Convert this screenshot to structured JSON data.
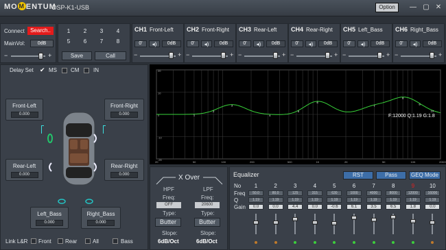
{
  "app": {
    "logo": "MOMENTUM",
    "title": "DSP-K1-USB",
    "option_label": "Option"
  },
  "window": {
    "min_glyph": "—",
    "max_glyph": "▢",
    "close_glyph": "✕"
  },
  "connect": {
    "connect_label": "Connect",
    "search_label": "Search..",
    "mainvol_label": "MainVol:",
    "mainvol_value": "0dB",
    "minus": "−",
    "plus": "+"
  },
  "presets": {
    "buttons": [
      "1",
      "2",
      "3",
      "4",
      "5",
      "6",
      "7",
      "8"
    ],
    "save": "Save",
    "call": "Call"
  },
  "channels": [
    {
      "code": "CH1",
      "name": "Front-Left",
      "delay": "0'",
      "gain": "0dB"
    },
    {
      "code": "CH2",
      "name": "Front-Right",
      "delay": "0'",
      "gain": "0dB"
    },
    {
      "code": "CH3",
      "name": "Rear-Left",
      "delay": "0'",
      "gain": "0dB"
    },
    {
      "code": "CH4",
      "name": "Rear-Right",
      "delay": "0'",
      "gain": "0dB"
    },
    {
      "code": "CH5",
      "name": "Left_Bass",
      "delay": "0'",
      "gain": "0dB"
    },
    {
      "code": "CH6",
      "name": "Right_Bass",
      "delay": "0'",
      "gain": "0dB"
    }
  ],
  "delay_set": {
    "label": "Delay Set",
    "options": [
      "MS",
      "CM",
      "IN"
    ],
    "checked": "MS"
  },
  "speakers": [
    {
      "name": "Front-Left",
      "value": "0.000"
    },
    {
      "name": "Front-Right",
      "value": "0.000"
    },
    {
      "name": "Rear-Left",
      "value": "0.000"
    },
    {
      "name": "Rear-Right",
      "value": "0.000"
    },
    {
      "name": "Left_Bass",
      "value": "0.000"
    },
    {
      "name": "Right_Bass",
      "value": "0.000"
    }
  ],
  "link": {
    "label": "Link L&R",
    "options": [
      "Front",
      "Rear",
      "All",
      "Bass"
    ]
  },
  "graph": {
    "y_ticks": [
      "20",
      "10",
      "0",
      "-10",
      "-20"
    ],
    "x_ticks": [
      "20",
      "50",
      "100",
      "200",
      "500",
      "1K",
      "2K",
      "5K",
      "10K",
      "20KHz"
    ],
    "readout": "F:12000 Q:1.19 G:1.8",
    "curve_color": "#39d43a"
  },
  "xover": {
    "title": "X Over",
    "hpf": {
      "label": "HPF",
      "freq_label": "Freq:",
      "freq": "OFF",
      "type_label": "Type:",
      "type": "Butter",
      "slope_label": "Slope:",
      "slope": "6dB/Oct"
    },
    "lpf": {
      "label": "LPF",
      "freq_label": "Freq:",
      "freq": "20600",
      "type_label": "Type:",
      "type": "Butter",
      "slope_label": "Slope:",
      "slope": "6dB/Oct"
    }
  },
  "eq": {
    "title": "Equalizer",
    "rst": "RST",
    "pass": "Pass",
    "geq": "GEQ Mode",
    "row_labels": {
      "no": "No",
      "freq": "Freq",
      "q": "Q",
      "gain": "Gain"
    },
    "bands": [
      {
        "no": "1",
        "freq": "50.0",
        "q": "1.19",
        "gain": "0.0",
        "led": "#c07a2a"
      },
      {
        "no": "2",
        "freq": "80.0",
        "q": "1.19",
        "gain": "0.0",
        "led": "#c07a2a"
      },
      {
        "no": "3",
        "freq": "125",
        "q": "1.19",
        "gain": "4.4",
        "led": "#3ccf3c"
      },
      {
        "no": "4",
        "freq": "315",
        "q": "1.19",
        "gain": "0.0",
        "led": "#3ccf3c"
      },
      {
        "no": "5",
        "freq": "630",
        "q": "1.19",
        "gain": "-0.6",
        "led": "#3ccf3c"
      },
      {
        "no": "6",
        "freq": "1000",
        "q": "1.19",
        "gain": "6.1",
        "led": "#3ccf3c"
      },
      {
        "no": "7",
        "freq": "4000",
        "q": "1.19",
        "gain": "3.5",
        "led": "#3ccf3c"
      },
      {
        "no": "8",
        "freq": "8000",
        "q": "1.19",
        "gain": "6.5",
        "led": "#3ccf3c"
      },
      {
        "no": "9",
        "freq": "12000",
        "q": "1.19",
        "gain": "1.8",
        "led": "#3ccf3c"
      },
      {
        "no": "10",
        "freq": "16000",
        "q": "1.19",
        "gain": "0.0",
        "led": "#c07a2a"
      }
    ],
    "selected_band": "9"
  }
}
